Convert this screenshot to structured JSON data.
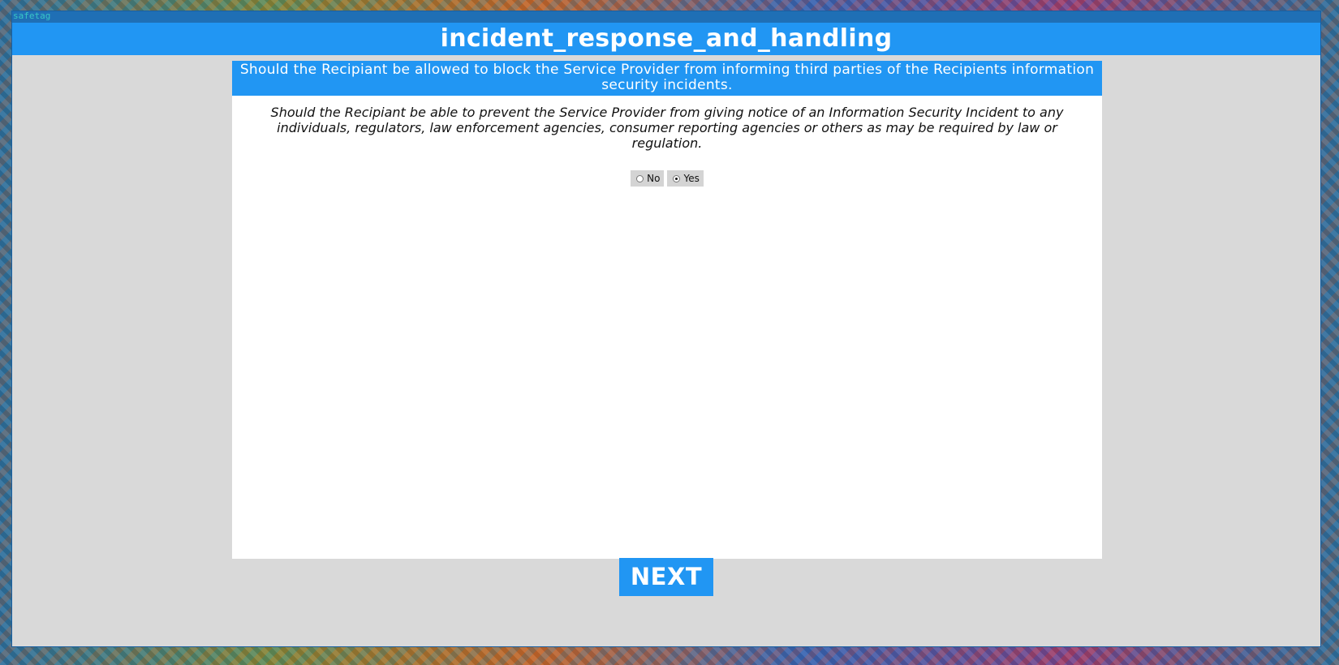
{
  "window": {
    "title": "safetag"
  },
  "header": {
    "title": "incident_response_and_handling"
  },
  "question": {
    "title": "Should the Recipiant be allowed to block the Service Provider from informing third parties of the Recipients information security incidents.",
    "description": "Should the Recipiant be able to prevent the Service Provider from giving notice of an Information Security Incident to any individuals, regulators, law enforcement agencies, consumer reporting agencies or others as may be required by law or regulation.",
    "options": [
      {
        "label": "No",
        "selected": false
      },
      {
        "label": "Yes",
        "selected": true
      }
    ]
  },
  "actions": {
    "next_label": "NEXT"
  },
  "colors": {
    "accent": "#2196f3",
    "window_bg": "#d9d9d9",
    "panel_bg": "#ffffff",
    "titlebar": "#1f6fb5",
    "titlebar_text": "#39c6c6"
  }
}
